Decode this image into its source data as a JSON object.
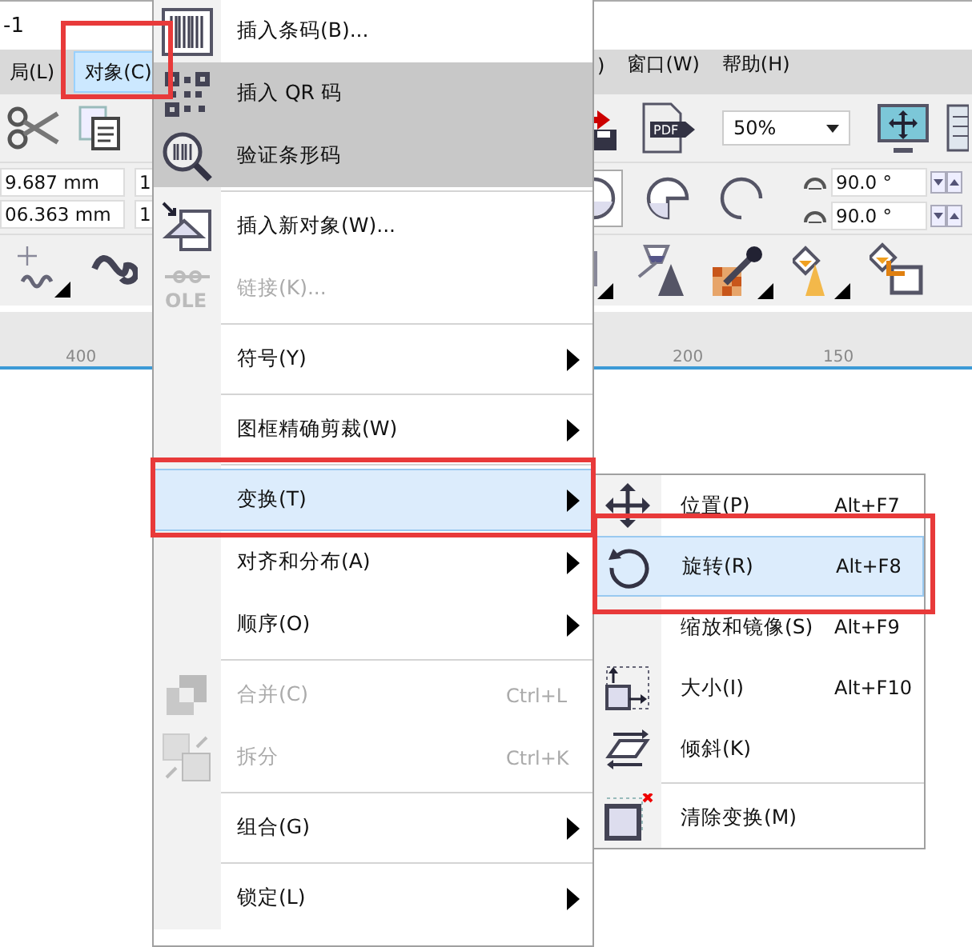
{
  "title_bar": {
    "title": "-1"
  },
  "menubar": {
    "left_items": [
      {
        "label": "局(L)",
        "selected": false,
        "annotated": false
      },
      {
        "label": "对象(C)",
        "selected": true,
        "annotated": true
      }
    ],
    "right_items": [
      {
        "label": ")",
        "selected": false,
        "annotated": false
      },
      {
        "label": "窗口(W)",
        "selected": false,
        "annotated": false
      },
      {
        "label": "帮助(H)",
        "selected": false,
        "annotated": false
      }
    ]
  },
  "toolbar": {
    "pdf_label": "PDF",
    "zoom": "50%"
  },
  "property_bar": {
    "position_fields": [
      "9.687 mm",
      "06.363 mm"
    ],
    "size_fields": [
      "1",
      "1"
    ],
    "ellipse_modes": [
      {
        "selected": true
      },
      {
        "selected": false
      },
      {
        "selected": false
      }
    ],
    "angles": [
      "90.0 °",
      "90.0 °"
    ]
  },
  "ruler": {
    "labels": [
      "400",
      "200",
      "150"
    ]
  },
  "object_menu": [
    {
      "kind": "item",
      "label": "插入条码(B)...",
      "disabled": false,
      "submenu": false,
      "selected": false,
      "shaded": false,
      "annotated": false
    },
    {
      "kind": "item",
      "label": "插入 QR 码",
      "disabled": false,
      "submenu": false,
      "selected": false,
      "shaded": true,
      "annotated": false
    },
    {
      "kind": "item",
      "label": "验证条形码",
      "disabled": false,
      "submenu": false,
      "selected": false,
      "shaded": true,
      "annotated": false
    },
    {
      "kind": "separator"
    },
    {
      "kind": "item",
      "label": "插入新对象(W)...",
      "disabled": false,
      "submenu": false,
      "selected": false,
      "shaded": false,
      "annotated": false
    },
    {
      "kind": "item",
      "label": "链接(K)...",
      "icon_label": "OLE",
      "disabled": true,
      "submenu": false,
      "selected": false,
      "shaded": false,
      "annotated": false
    },
    {
      "kind": "separator"
    },
    {
      "kind": "item",
      "label": "符号(Y)",
      "disabled": false,
      "submenu": true,
      "selected": false,
      "shaded": false,
      "annotated": false
    },
    {
      "kind": "separator"
    },
    {
      "kind": "item",
      "label": "图框精确剪裁(W)",
      "disabled": false,
      "submenu": true,
      "selected": false,
      "shaded": false,
      "annotated": false
    },
    {
      "kind": "separator"
    },
    {
      "kind": "item",
      "label": "变换(T)",
      "disabled": false,
      "submenu": true,
      "selected": true,
      "shaded": false,
      "annotated": true
    },
    {
      "kind": "item",
      "label": "对齐和分布(A)",
      "disabled": false,
      "submenu": true,
      "selected": false,
      "shaded": false,
      "annotated": false
    },
    {
      "kind": "item",
      "label": "顺序(O)",
      "disabled": false,
      "submenu": true,
      "selected": false,
      "shaded": false,
      "annotated": false
    },
    {
      "kind": "separator"
    },
    {
      "kind": "item",
      "label": "合并(C)",
      "shortcut": "Ctrl+L",
      "disabled": true,
      "submenu": false,
      "selected": false,
      "shaded": false,
      "annotated": false
    },
    {
      "kind": "item",
      "label": "拆分",
      "shortcut": "Ctrl+K",
      "disabled": true,
      "submenu": false,
      "selected": false,
      "shaded": false,
      "annotated": false
    },
    {
      "kind": "separator"
    },
    {
      "kind": "item",
      "label": "组合(G)",
      "disabled": false,
      "submenu": true,
      "selected": false,
      "shaded": false,
      "annotated": false
    },
    {
      "kind": "separator"
    },
    {
      "kind": "item",
      "label": "锁定(L)",
      "disabled": false,
      "submenu": true,
      "selected": false,
      "shaded": false,
      "annotated": false
    }
  ],
  "transform_menu": [
    {
      "kind": "item",
      "label": "位置(P)",
      "shortcut": "Alt+F7",
      "selected": false,
      "annotated": false
    },
    {
      "kind": "item",
      "label": "旋转(R)",
      "shortcut": "Alt+F8",
      "selected": true,
      "annotated": true
    },
    {
      "kind": "item",
      "label": "缩放和镜像(S)",
      "shortcut": "Alt+F9",
      "selected": false,
      "annotated": false
    },
    {
      "kind": "item",
      "label": "大小(I)",
      "shortcut": "Alt+F10",
      "selected": false,
      "annotated": false
    },
    {
      "kind": "item",
      "label": "倾斜(K)",
      "selected": false,
      "annotated": false
    },
    {
      "kind": "separator"
    },
    {
      "kind": "item",
      "label": "清除变换(M)",
      "selected": false,
      "annotated": false
    }
  ]
}
